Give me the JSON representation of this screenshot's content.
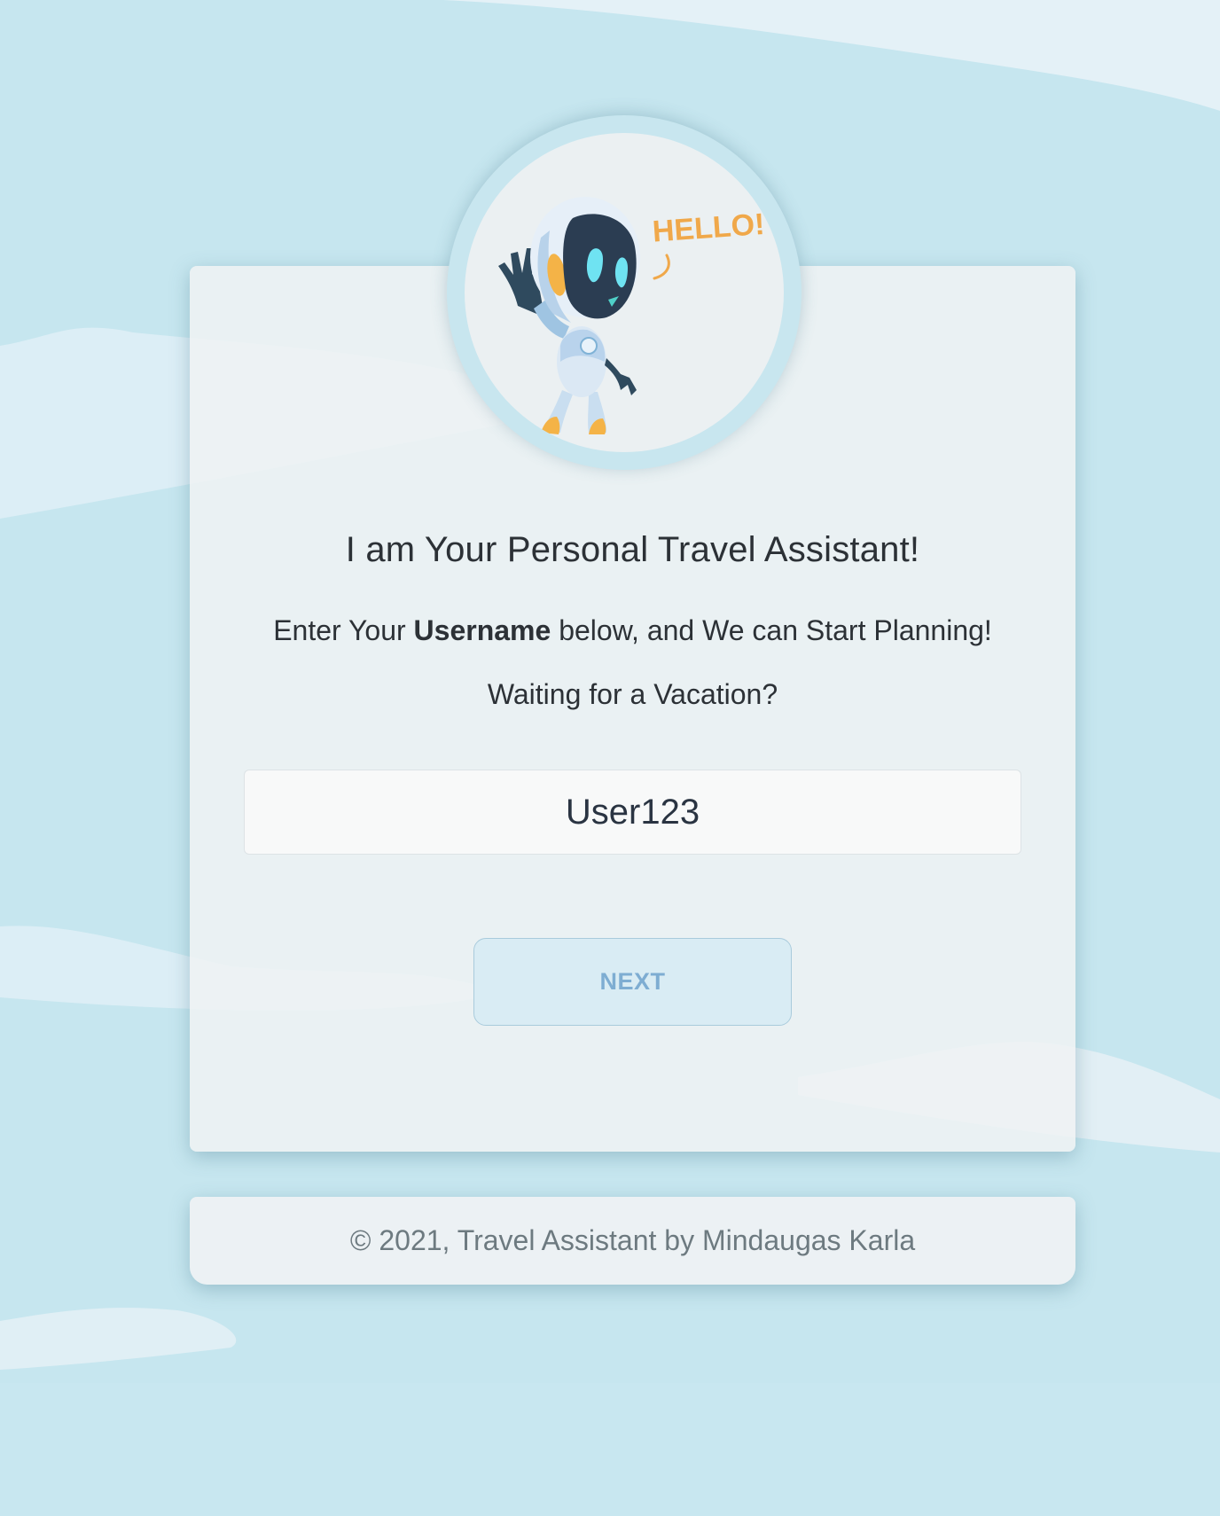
{
  "theme": {
    "background": "#c6e6ef",
    "card": "#eef1f3",
    "accent": "#7eadd2",
    "hello_badge": "#f0a84a"
  },
  "avatar": {
    "icon": "waving-robot-icon",
    "speech_text": "HELLO!"
  },
  "main": {
    "title": "I am Your Personal Travel Assistant!",
    "subtitle_before": "Enter Your ",
    "subtitle_bold": "Username",
    "subtitle_after": " below, and We can Start Planning!",
    "question": "Waiting for a Vacation?"
  },
  "form": {
    "username_value": "User123",
    "next_label": "NEXT"
  },
  "footer": {
    "text": "© 2021, Travel Assistant by Mindaugas Karla"
  }
}
